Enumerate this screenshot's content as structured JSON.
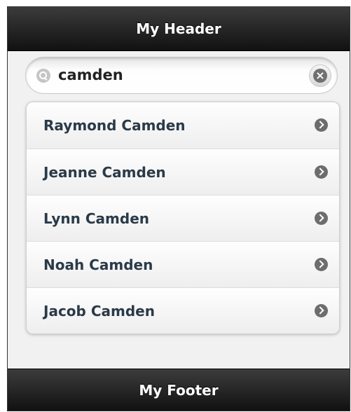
{
  "header": {
    "title": "My Header"
  },
  "search": {
    "value": "camden",
    "placeholder": ""
  },
  "list": {
    "items": [
      {
        "label": "Raymond Camden"
      },
      {
        "label": "Jeanne Camden"
      },
      {
        "label": "Lynn Camden"
      },
      {
        "label": "Noah Camden"
      },
      {
        "label": "Jacob Camden"
      }
    ]
  },
  "footer": {
    "title": "My Footer"
  },
  "icons": {
    "search": "search-icon",
    "clear": "clear-icon",
    "item_arrow": "chevron-right-icon"
  },
  "colors": {
    "bar_top": "#3c3c3c",
    "bar_bottom": "#111111",
    "item_text": "#2a3a48",
    "page_bg": "#f1f1f1"
  }
}
